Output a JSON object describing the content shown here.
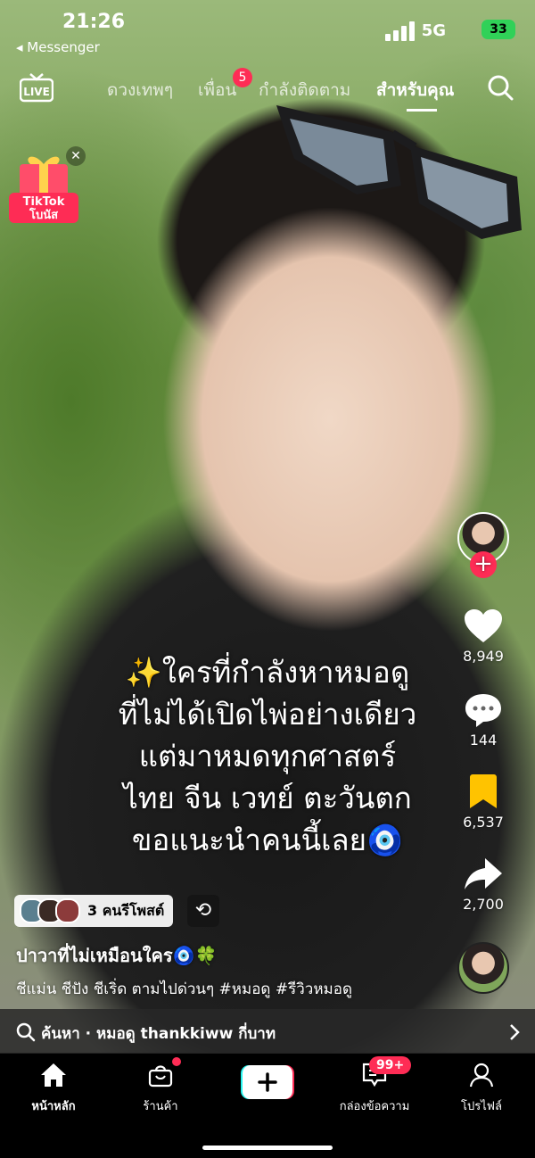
{
  "status_bar": {
    "time": "21:26",
    "back_app": "◂ Messenger",
    "network": "5G",
    "battery": "33"
  },
  "top_nav": {
    "live": "LIVE",
    "tabs": [
      "ดวงเทพๆ",
      "เพื่อน",
      "กำลังติดตาม",
      "สำหรับคุณ"
    ],
    "active_tab": "สำหรับคุณ",
    "friends_badge": "5"
  },
  "promo": {
    "label_line1": "TikTok",
    "label_line2": "โบนัส"
  },
  "caption": {
    "lines": [
      "✨ใครที่กำลังหาหมอดู",
      "ที่ไม่ได้เปิดไพ่อย่างเดียว",
      "แต่มาหมดทุกศาสตร์",
      "ไทย จีน เวทย์ ตะวันตก",
      "ขอแนะนำคนนี้เลย🧿"
    ]
  },
  "actions": {
    "likes": "8,949",
    "comments": "144",
    "saves": "6,537",
    "shares": "2,700"
  },
  "repost": {
    "label": "3 คนรีโพสต์"
  },
  "author": {
    "name": "ปาวาที่ไม่เหมือนใคร🧿🍀"
  },
  "description": "ชีแม่น ชีปัง ชีเริ่ด ตามไปด่วนๆ #หมอดู #รีวิวหมอดู",
  "search": {
    "text": "ค้นหา · หมอดู thankkiww กี่บาท"
  },
  "tabbar": {
    "home": "หน้าหลัก",
    "shop": "ร้านค้า",
    "inbox": "กล่องข้อความ",
    "profile": "โปรไฟล์",
    "inbox_badge": "99+"
  },
  "colors": {
    "accent": "#fe2c55",
    "battery": "#30d158",
    "bookmark": "#ffc300"
  }
}
